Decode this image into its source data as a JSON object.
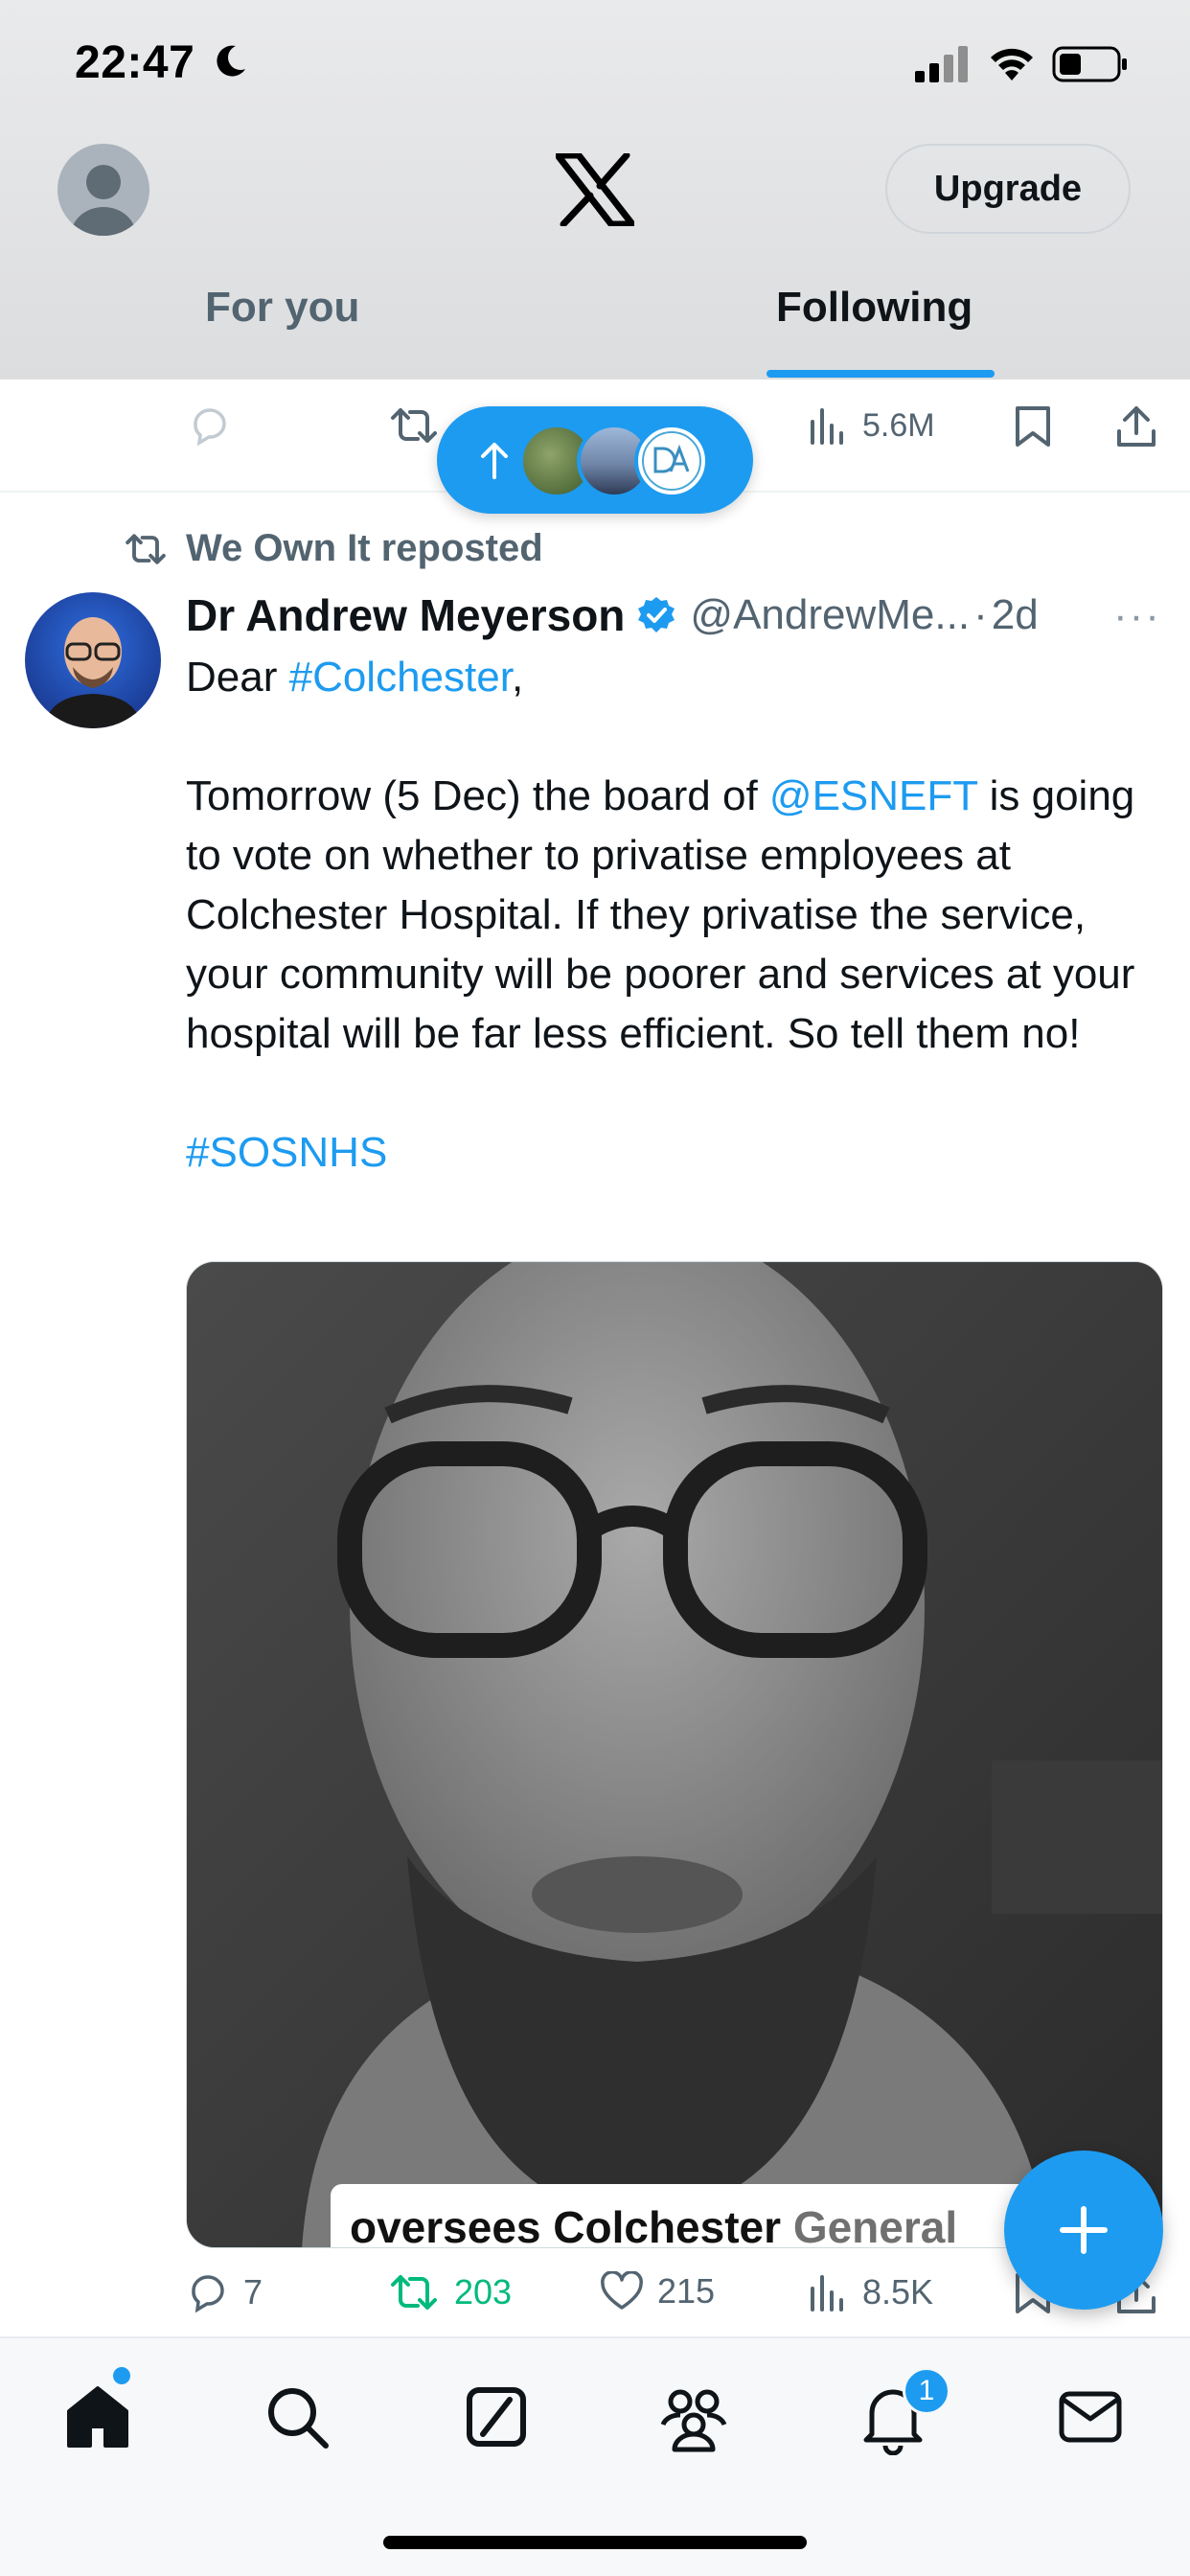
{
  "status_bar": {
    "time": "22:47"
  },
  "header": {
    "upgrade_label": "Upgrade",
    "tabs": [
      {
        "label": "For you",
        "active": false
      },
      {
        "label": "Following",
        "active": true
      }
    ]
  },
  "previous_post": {
    "views": "5.6M"
  },
  "tweet": {
    "repost_label": "We Own It reposted",
    "author_name": "Dr Andrew Meyerson",
    "handle": "@AndrewMe...",
    "dot": "·",
    "time": "2d",
    "more": "···",
    "text": {
      "greeting_prefix": "Dear ",
      "greeting_tag": "#Colchester",
      "greeting_suffix": ",",
      "p1_prefix": "Tomorrow (5 Dec) the board of ",
      "p1_mention": "@ESNEFT",
      "p1_suffix": " is going to vote on whether to privatise employees at Colchester Hospital. If they privatise the service, your community will be poorer and services at your hospital will be far less efficient. So tell them no!",
      "hashtag": "#SOSNHS"
    },
    "video_caption": {
      "dark": "oversees Colchester ",
      "grey": "General"
    },
    "replies": "7",
    "reposts": "203",
    "likes": "215",
    "views": "8.5K"
  },
  "bottom_nav": {
    "notifications_badge": "1"
  },
  "colors": {
    "accent": "#1d9bf0",
    "repost_green": "#00ba7c",
    "muted": "#536471"
  },
  "icons": [
    "moon-icon",
    "signal-icon",
    "wifi-icon",
    "battery-icon",
    "x-logo-icon",
    "reply-icon",
    "repost-icon",
    "like-icon",
    "views-icon",
    "bookmark-icon",
    "share-icon",
    "home-icon",
    "search-icon",
    "grok-icon",
    "communities-icon",
    "bell-icon",
    "mail-icon",
    "plus-icon",
    "verified-icon"
  ]
}
